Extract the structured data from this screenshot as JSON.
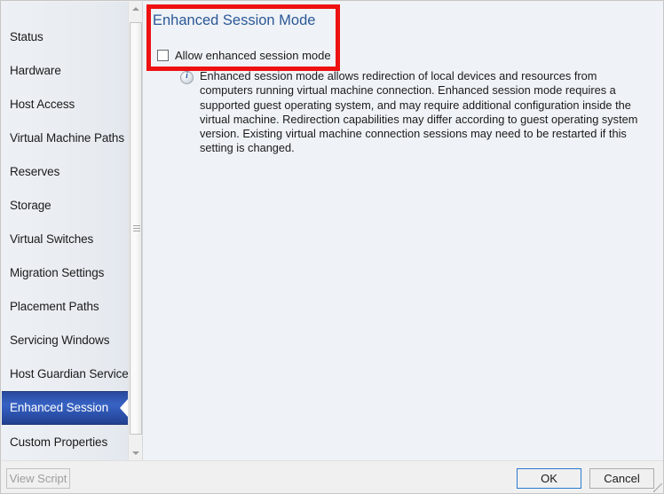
{
  "window": {
    "background_color": "#eff3f7",
    "frame_color": "#c6c6c6"
  },
  "sidebar": {
    "items": [
      {
        "label": "Status",
        "selected": false
      },
      {
        "label": "Hardware",
        "selected": false
      },
      {
        "label": "Host Access",
        "selected": false
      },
      {
        "label": "Virtual Machine Paths",
        "selected": false
      },
      {
        "label": "Reserves",
        "selected": false
      },
      {
        "label": "Storage",
        "selected": false
      },
      {
        "label": "Virtual Switches",
        "selected": false
      },
      {
        "label": "Migration Settings",
        "selected": false
      },
      {
        "label": "Placement Paths",
        "selected": false
      },
      {
        "label": "Servicing Windows",
        "selected": false
      },
      {
        "label": "Host Guardian Service",
        "selected": false
      },
      {
        "label": "Enhanced Session",
        "selected": true
      },
      {
        "label": "Custom Properties",
        "selected": false
      }
    ],
    "selected_color": "#2f57b4",
    "scrollbar": {
      "up_arrow_icon": "triangle-up-icon",
      "down_arrow_icon": "triangle-down-icon",
      "thumb_grip_icon": "grip-lines-icon"
    }
  },
  "content": {
    "title": "Enhanced Session Mode",
    "title_color": "#2b5797",
    "checkbox": {
      "label": "Allow enhanced session mode",
      "checked": false
    },
    "info": {
      "icon": "info-circle-icon",
      "text": "Enhanced session mode allows redirection of local devices and resources from computers running virtual machine connection. Enhanced session mode requires a supported guest operating system, and may require additional configuration inside the virtual machine. Redirection capabilities may differ according to guest operating system version. Existing virtual machine connection sessions may need to be restarted if this setting is changed."
    }
  },
  "annotation": {
    "highlight_color": "#ee1111",
    "shape": "rectangle-outline"
  },
  "footer": {
    "view_script_label": "View Script",
    "ok_label": "OK",
    "cancel_label": "Cancel",
    "ok_focus_color": "#2a7bd0"
  }
}
